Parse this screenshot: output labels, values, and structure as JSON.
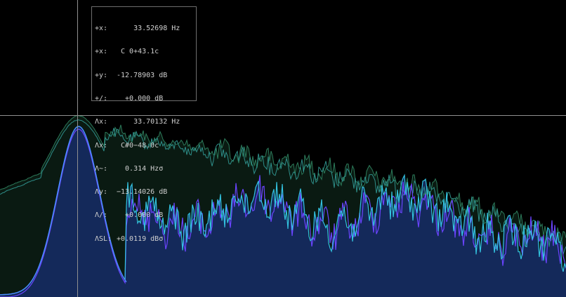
{
  "colors": {
    "background": "#000000",
    "crosshair": "#8f8f8f",
    "fill_primary": "#14295a",
    "fill_secondary": "#0a1a12",
    "line_blue": "#4a8cff",
    "line_cyan": "#33c3e0",
    "line_violet": "#6a44ff",
    "line_green": "#2c7a5a"
  },
  "readout": {
    "rows": [
      {
        "label": "+x:",
        "value": "    33.52698 Hz"
      },
      {
        "label": "+x:",
        "value": " C 0+43.1c"
      },
      {
        "label": "+y:",
        "value": "-12.78903 dB"
      },
      {
        "label": "+/:",
        "value": "  +0.000 dB"
      },
      {
        "label": "Λx:",
        "value": "    33.70132 Hz"
      },
      {
        "label": "Λx:",
        "value": " C#0−48.0c"
      },
      {
        "label": "Λ~:",
        "value": "  0.314 Hzσ"
      },
      {
        "label": "Λy:",
        "value": "−13.14026 dB"
      },
      {
        "label": "Λ/:",
        "value": "  +0.000 dB"
      },
      {
        "label": "ΛSL:",
        "value": "+0.0119 dBσ"
      }
    ]
  }
}
